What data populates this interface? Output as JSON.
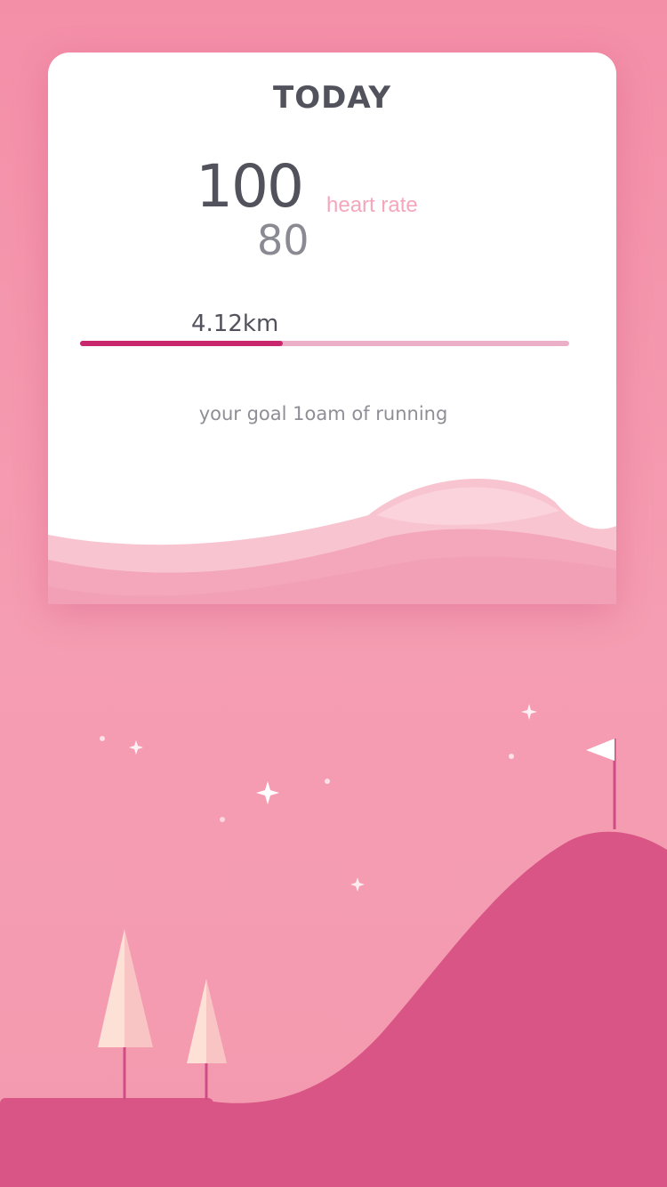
{
  "card": {
    "title": "TODAY",
    "heart_rate_high": "100",
    "heart_rate_low": "80",
    "heart_rate_label": "heart rate",
    "distance": "4.12km",
    "distance_progress": 0.415,
    "goal_text": "your goal 1oam of running"
  },
  "colors": {
    "background": "#f49ab0",
    "card": "#ffffff",
    "title_text": "#52525c",
    "accent_pink": "#f5a6bd",
    "progress_fill": "#c8266d",
    "progress_track": "#ebb0c8",
    "hill": "#d85585",
    "tree_light": "#fde0d6"
  },
  "icons": [
    "sparkle-icon",
    "flag-icon",
    "tree-icon",
    "hill-icon"
  ]
}
